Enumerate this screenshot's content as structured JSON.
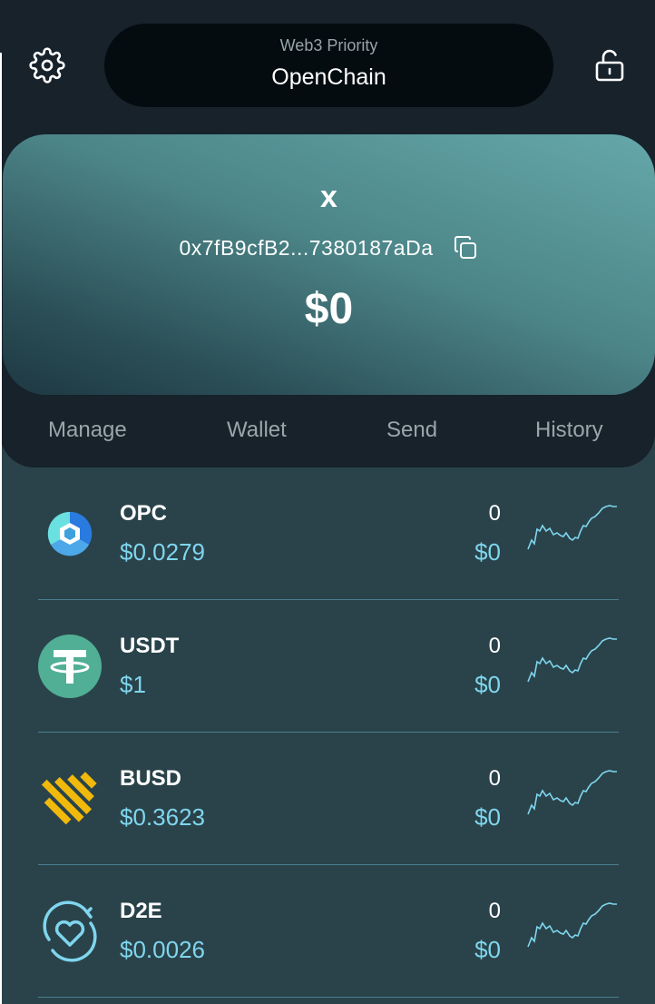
{
  "header": {
    "settings_icon": "gear-icon",
    "lock_icon": "unlock-icon",
    "network": {
      "label": "Web3 Priority",
      "name": "OpenChain"
    }
  },
  "account": {
    "name": "x",
    "address": "0x7fB9cfB2...7380187aDa",
    "copy_icon": "copy-icon",
    "balance": "$0"
  },
  "tabs": [
    {
      "label": "Manage"
    },
    {
      "label": "Wallet"
    },
    {
      "label": "Send"
    },
    {
      "label": "History"
    }
  ],
  "tokens": [
    {
      "symbol": "OPC",
      "price": "$0.0279",
      "quantity": "0",
      "value": "$0",
      "icon": "opc-logo-icon"
    },
    {
      "symbol": "USDT",
      "price": "$1",
      "quantity": "0",
      "value": "$0",
      "icon": "tether-logo-icon"
    },
    {
      "symbol": "BUSD",
      "price": "$0.3623",
      "quantity": "0",
      "value": "$0",
      "icon": "busd-logo-icon"
    },
    {
      "symbol": "D2E",
      "price": "$0.0026",
      "quantity": "0",
      "value": "$0",
      "icon": "d2e-logo-icon"
    }
  ],
  "colors": {
    "background": "#2a434a",
    "header_background": "#17222b",
    "accent": "#7fd6ee",
    "divider": "#4b7d8f"
  }
}
